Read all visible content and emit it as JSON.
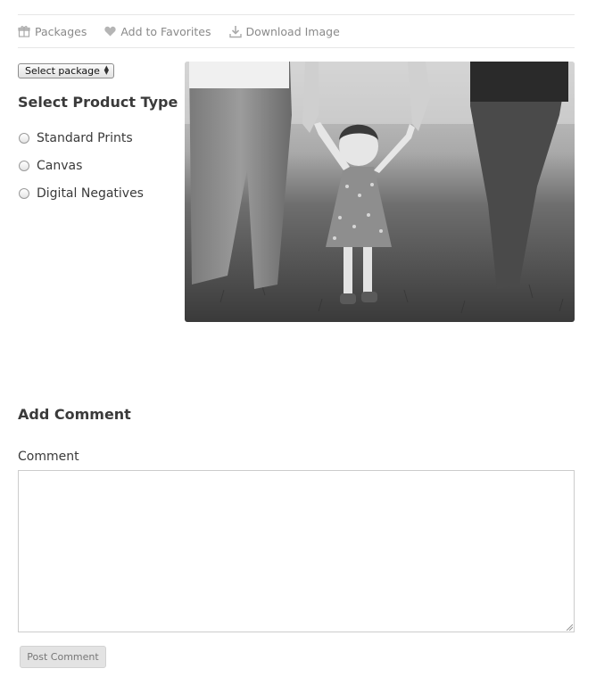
{
  "toolbar": {
    "packages": "Packages",
    "favorites": "Add to Favorites",
    "download": "Download Image"
  },
  "package_select": {
    "selected": "Select package"
  },
  "product_type": {
    "heading": "Select Product Type",
    "options": [
      "Standard Prints",
      "Canvas",
      "Digital Negatives"
    ]
  },
  "comment": {
    "heading": "Add Comment",
    "label": "Comment",
    "value": "",
    "button": "Post Comment"
  },
  "icons": {
    "packages": "gift-icon",
    "favorites": "heart-icon",
    "download": "download-icon"
  },
  "colors": {
    "muted_text": "#8a8a8a",
    "heading": "#3a3a3a",
    "button_bg": "#e3e3e3"
  }
}
